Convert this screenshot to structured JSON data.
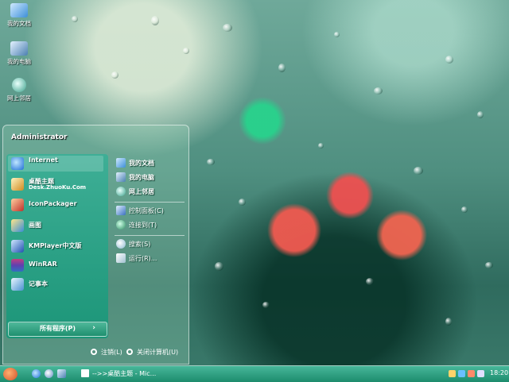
{
  "desktop": {
    "icons": [
      {
        "label": "我的文档",
        "icon": "my-documents-icon"
      },
      {
        "label": "我的电脑",
        "icon": "my-computer-icon"
      },
      {
        "label": "网上邻居",
        "icon": "network-icon"
      }
    ]
  },
  "start_menu": {
    "user": "Administrator",
    "pinned": [
      {
        "label": "Internet",
        "icon": "internet-explorer-icon"
      },
      {
        "label": "桌酷主题",
        "sub": "Desk.ZhuoKu.Com",
        "icon": "theme-icon"
      },
      {
        "label": "IconPackager",
        "icon": "iconpackager-icon"
      },
      {
        "label": "画图",
        "icon": "paint-icon"
      },
      {
        "label": "KMPlayer中文版",
        "icon": "kmplayer-icon"
      },
      {
        "label": "WinRAR",
        "icon": "winrar-icon"
      },
      {
        "label": "记事本",
        "icon": "notepad-icon"
      }
    ],
    "all_programs": "所有程序(P)",
    "all_programs_arrow": "›",
    "right": [
      {
        "label": "我的文档",
        "icon": "my-documents-icon"
      },
      {
        "label": "我的电脑",
        "icon": "my-computer-icon"
      },
      {
        "label": "网上邻居",
        "icon": "network-icon"
      },
      {
        "label": "控制面板(C)",
        "icon": "control-panel-icon"
      },
      {
        "label": "连接到(T)",
        "icon": "connect-icon"
      },
      {
        "label": "搜索(S)",
        "icon": "search-icon"
      },
      {
        "label": "运行(R)...",
        "icon": "run-icon"
      }
    ],
    "logoff": "注销(L)",
    "shutdown": "关闭计算机(U)"
  },
  "taskbar": {
    "task_label": "-->>桌酷主题 - Mic...",
    "clock": "18:20"
  },
  "colors": {
    "accent": "#1d8c6d",
    "panel": "#2aa888"
  }
}
